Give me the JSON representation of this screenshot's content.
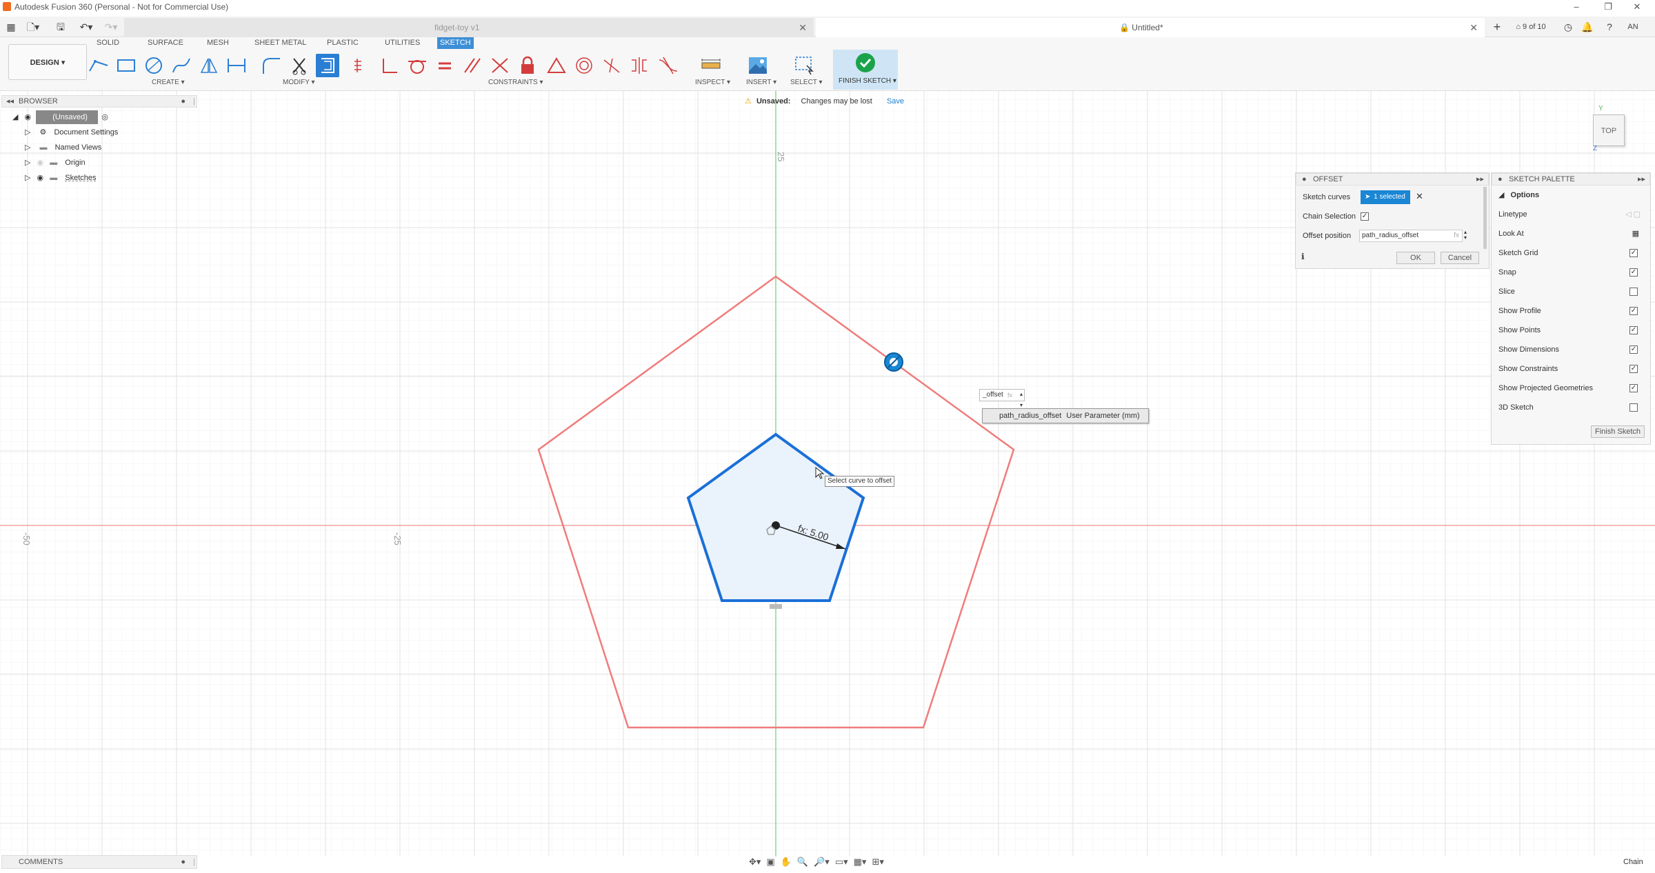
{
  "titlebar": {
    "title": "Autodesk Fusion 360 (Personal - Not for Commercial Use)",
    "controls": [
      "–",
      "❐",
      "✕"
    ]
  },
  "tabs": {
    "tab1_label": "fidget-toy v1",
    "tab2_label": "Untitled*",
    "counter": "9 of 10",
    "user_initials": "AN"
  },
  "ribbon": {
    "workspace": "DESIGN ▾",
    "tabs": [
      "SOLID",
      "SURFACE",
      "MESH",
      "SHEET METAL",
      "PLASTIC",
      "UTILITIES",
      "SKETCH"
    ],
    "groups": {
      "create": "CREATE ▾",
      "modify": "MODIFY ▾",
      "constraints": "CONSTRAINTS ▾",
      "inspect": "INSPECT ▾",
      "insert": "INSERT ▾",
      "select": "SELECT ▾",
      "finish": "FINISH SKETCH ▾"
    }
  },
  "browser": {
    "title": "BROWSER",
    "items": [
      "(Unsaved)",
      "Document Settings",
      "Named Views",
      "Origin",
      "Sketches"
    ]
  },
  "warning": {
    "label": "Unsaved:",
    "message": "Changes may be lost",
    "save": "Save"
  },
  "canvas": {
    "axis_labels": [
      "25",
      "-50",
      "-25"
    ],
    "dimension": "fx: 5.00",
    "input_value": "_offset",
    "input_fx": "fx",
    "autocomplete_name": "path_radius_offset",
    "autocomplete_type": "User Parameter (mm)",
    "tooltip": "Select curve to offset",
    "viewcube": "TOP"
  },
  "offset_dialog": {
    "title": "OFFSET",
    "sketch_curves_label": "Sketch curves",
    "selected": "1 selected",
    "chain_label": "Chain Selection",
    "position_label": "Offset position",
    "position_value": "path_radius_offset",
    "fx": "fx",
    "ok": "OK",
    "cancel": "Cancel"
  },
  "palette": {
    "title": "SKETCH PALETTE",
    "section": "Options",
    "rows": [
      {
        "label": "Linetype",
        "checked": null
      },
      {
        "label": "Look At",
        "checked": null
      },
      {
        "label": "Sketch Grid",
        "checked": true
      },
      {
        "label": "Snap",
        "checked": true
      },
      {
        "label": "Slice",
        "checked": false
      },
      {
        "label": "Show Profile",
        "checked": true
      },
      {
        "label": "Show Points",
        "checked": true
      },
      {
        "label": "Show Dimensions",
        "checked": true
      },
      {
        "label": "Show Constraints",
        "checked": true
      },
      {
        "label": "Show Projected Geometries",
        "checked": true
      },
      {
        "label": "3D Sketch",
        "checked": false
      }
    ],
    "finish": "Finish Sketch"
  },
  "bottom": {
    "comments": "COMMENTS",
    "status": "Chain"
  },
  "colors": {
    "accent": "#0696d7",
    "sketch_blue": "#1a6fd8",
    "offset_red": "#f07b7b",
    "axis_green": "#7bd67b",
    "axis_red": "#f0a0a0"
  }
}
